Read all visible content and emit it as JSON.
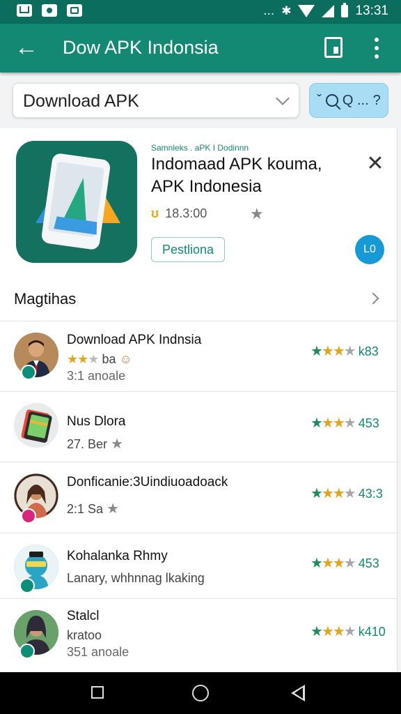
{
  "status_bar": {
    "time": "13:31",
    "dots": "..."
  },
  "toolbar": {
    "title": "Dow APK Indonsia",
    "back_glyph": "←"
  },
  "search": {
    "dropdown_value": "Download APK",
    "button_label": "Q ...",
    "button_prefix": "ˇ",
    "button_suffix": "?"
  },
  "featured": {
    "meta": "Samnleks . aPK I Dodinnn",
    "title": "Indomaad APK kouma, APK Indonesia",
    "rating_count": "18.3:00",
    "action_label": "Pestliona",
    "fab_label": "L0",
    "close_glyph": "✕"
  },
  "section": {
    "title": "Magtihas"
  },
  "list": [
    {
      "title": "Download APK Indnsia",
      "subtitle": "ba",
      "line2": "3:1 anoale",
      "rating": "k83",
      "avatar_color": "#6b4a2f"
    },
    {
      "title": "Nus Dlora",
      "subtitle": "27. Ber",
      "line2": "",
      "rating": "453",
      "avatar_color": "#e5e8ea"
    },
    {
      "title": "Donficanie:3Uindiuoadoack",
      "subtitle": "2:1 Sa",
      "line2": "",
      "rating": "43:3",
      "avatar_color": "#c79a72"
    },
    {
      "title": "Kohalanka Rhmy",
      "subtitle": "Lanary, whhnnag lkaking",
      "line2": "",
      "rating": "453",
      "avatar_color": "#2da8c9"
    },
    {
      "title": "Stalcl",
      "subtitle": "kratoo",
      "line2": "351 anoale",
      "rating": "k410",
      "avatar_color": "#3a4a55"
    }
  ],
  "colors": {
    "primary": "#138873",
    "status_bar": "#0b6d5d",
    "star_green": "#1e8b5a",
    "star_gold": "#e4a31a",
    "fab": "#1799d6"
  }
}
